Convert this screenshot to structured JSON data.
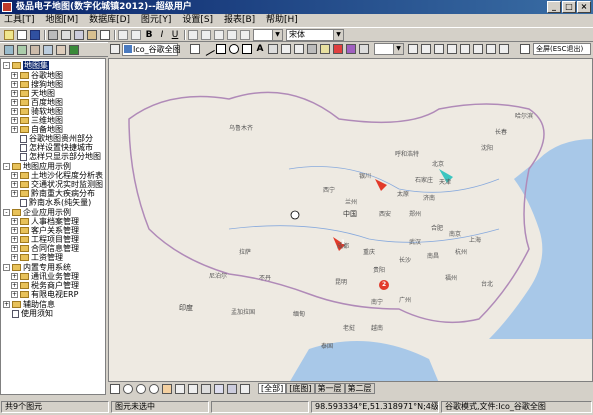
{
  "window": {
    "title": "极品电子地图(数字化城镇2012)--超级用户"
  },
  "menu": [
    "工具[T]",
    "地图[M]",
    "数据库[D]",
    "图元[Y]",
    "设置[S]",
    "报表[B]",
    "帮助[H]"
  ],
  "toolbar": {
    "font_value": "宋体"
  },
  "map_tab": {
    "label": "Ico_谷歌全图"
  },
  "fullscreen_label": "全屏(ESC退出)",
  "tree": {
    "root_label": "地图集",
    "groups": [
      {
        "label": "地图集",
        "items": [
          "谷歌地图",
          "搜狗地图",
          "天地图",
          "百度地图",
          "骑软地图",
          "三维地图",
          "自备地图",
          "谷歌地图贵州部分",
          "怎样设置快捷城市",
          "怎样只显示部分地图"
        ]
      },
      {
        "label": "地图应用示例",
        "items": [
          "土地沙化程度分析表",
          "交通状况实时监测图",
          "黔南重大疾病分布",
          "黔南水系(纯矢量)"
        ]
      },
      {
        "label": "企业应用示例",
        "items": [
          "人事档案管理",
          "客户关系管理",
          "工程项目管理",
          "合同信息管理",
          "工资管理"
        ]
      },
      {
        "label": "内置专用系统",
        "items": [
          "通讯业务管理",
          "税务商户管理",
          "有限电视ERP"
        ]
      },
      {
        "label": "辅助信息",
        "items": []
      },
      {
        "label": "使用须知",
        "items": []
      }
    ]
  },
  "map": {
    "labels": [
      "乌鲁木齐",
      "呼和浩特",
      "北京",
      "天津",
      "石家庄",
      "银川",
      "西宁",
      "太原",
      "济南",
      "郑州",
      "西安",
      "中国",
      "兰州",
      "拉萨",
      "成都",
      "重庆",
      "武汉",
      "长沙",
      "贵阳",
      "昆明",
      "南宁",
      "广州",
      "印度",
      "孟加拉国",
      "缅甸",
      "泰国",
      "老挝",
      "越南",
      "尼泊尔",
      "不丹",
      "南京",
      "合肥",
      "上海",
      "杭州",
      "南昌",
      "福州",
      "台北",
      "沈阳",
      "长春",
      "哈尔滨"
    ],
    "markers": [
      "1",
      "2"
    ]
  },
  "bottom_tabs": [
    "全部",
    "底图",
    "第一层",
    "第二层"
  ],
  "status": {
    "objects": "共9个图元",
    "selection": "图元未选中",
    "coords": "98.593334°E,51.318971°N;4级",
    "mode": "谷歌模式,文件:Ico_谷歌全图"
  },
  "colors": {
    "title_start": "#0a246a",
    "title_end": "#3a6ea5",
    "selection": "#0a246a",
    "marker": "#e23a2a",
    "accent_pin": "#3cc6c0"
  }
}
